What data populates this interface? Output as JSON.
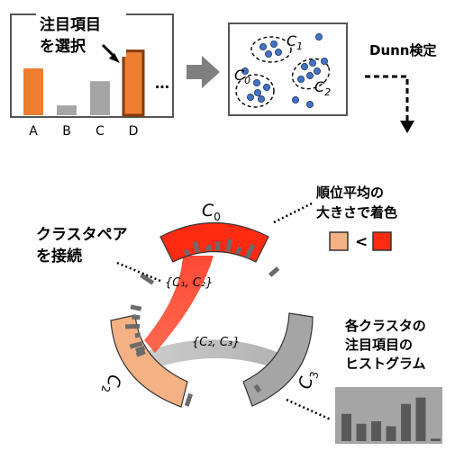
{
  "panel1": {
    "title_line1": "注目項目",
    "title_line2": "を選択",
    "more": "…",
    "bars": [
      {
        "label": "A",
        "value": 0.62,
        "color": "#ed7d31",
        "selected": false
      },
      {
        "label": "B",
        "value": 0.13,
        "color": "#a5a5a5",
        "selected": false
      },
      {
        "label": "C",
        "value": 0.45,
        "color": "#a5a5a5",
        "selected": false
      },
      {
        "label": "D",
        "value": 0.85,
        "color": "#ed7d31",
        "selected": true
      }
    ]
  },
  "panel2": {
    "clusters": [
      {
        "name": "C",
        "sub": "1"
      },
      {
        "name": "C",
        "sub": "0"
      },
      {
        "name": "C",
        "sub": "2"
      }
    ],
    "point_color": "#4472c4"
  },
  "dunn_label": "Dunn検定",
  "diagram": {
    "c0_label": "C",
    "c0_sub": "0",
    "c2_label": "C",
    "c2_sub": "2",
    "c3_label": "C",
    "c3_sub": "3",
    "pair1_label": "{C₁, C₂}",
    "pair2_label": "{C₂, C₃}",
    "connect_label_line1": "クラスタペア",
    "connect_label_line2": "を接続",
    "rank_label_line1": "順位平均の",
    "rank_label_line2": "大きさで着色",
    "legend_less": "<",
    "legend_low_color": "#f4b183",
    "legend_high_color": "#ff2a12",
    "histogram_label_line1": "各クラスタの",
    "histogram_label_line2": "注目項目の",
    "histogram_label_line3": "ヒストグラム",
    "histogram_values": [
      0.55,
      0.35,
      0.4,
      0.3,
      0.75,
      0.88,
      0.05
    ]
  }
}
